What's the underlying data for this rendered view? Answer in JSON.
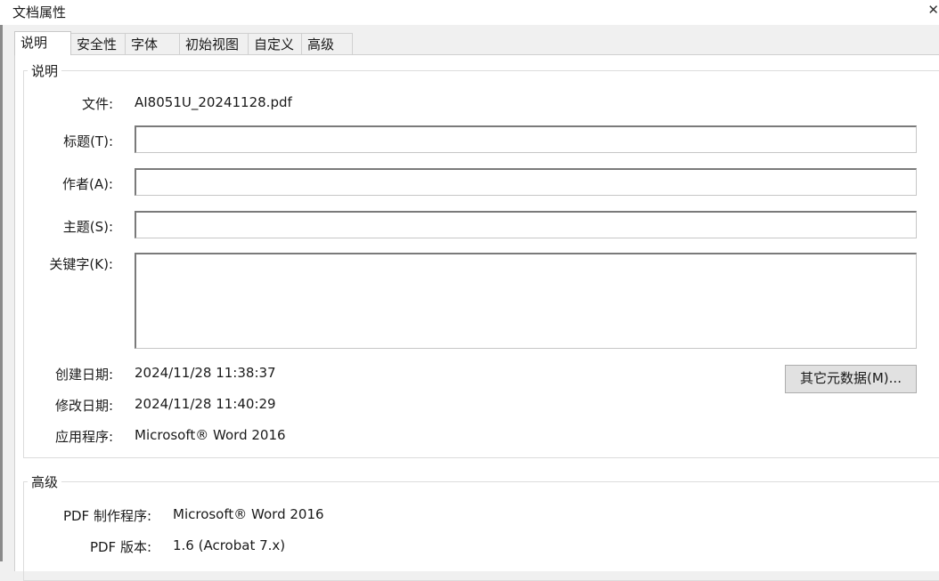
{
  "window": {
    "title": "文档属性",
    "close_glyph": "✕"
  },
  "tabs": [
    {
      "label": "说明",
      "active": true
    },
    {
      "label": "安全性"
    },
    {
      "label": "字体"
    },
    {
      "label": "初始视图"
    },
    {
      "label": "自定义"
    },
    {
      "label": "高级"
    }
  ],
  "description": {
    "legend": "说明",
    "file_label": "文件:",
    "file_value": "AI8051U_20241128.pdf",
    "title_label": "标题(T):",
    "title_value": "",
    "author_label": "作者(A):",
    "author_value": "",
    "subject_label": "主题(S):",
    "subject_value": "",
    "keywords_label": "关键字(K):",
    "keywords_value": "",
    "created_label": "创建日期:",
    "created_value": "2024/11/28 11:38:37",
    "modified_label": "修改日期:",
    "modified_value": "2024/11/28 11:40:29",
    "app_label": "应用程序:",
    "app_value": "Microsoft® Word 2016",
    "metadata_button": "其它元数据(M)..."
  },
  "advanced": {
    "legend": "高级",
    "producer_label": "PDF 制作程序:",
    "producer_value": "Microsoft® Word 2016",
    "version_label": "PDF 版本:",
    "version_value": "1.6 (Acrobat 7.x)"
  }
}
